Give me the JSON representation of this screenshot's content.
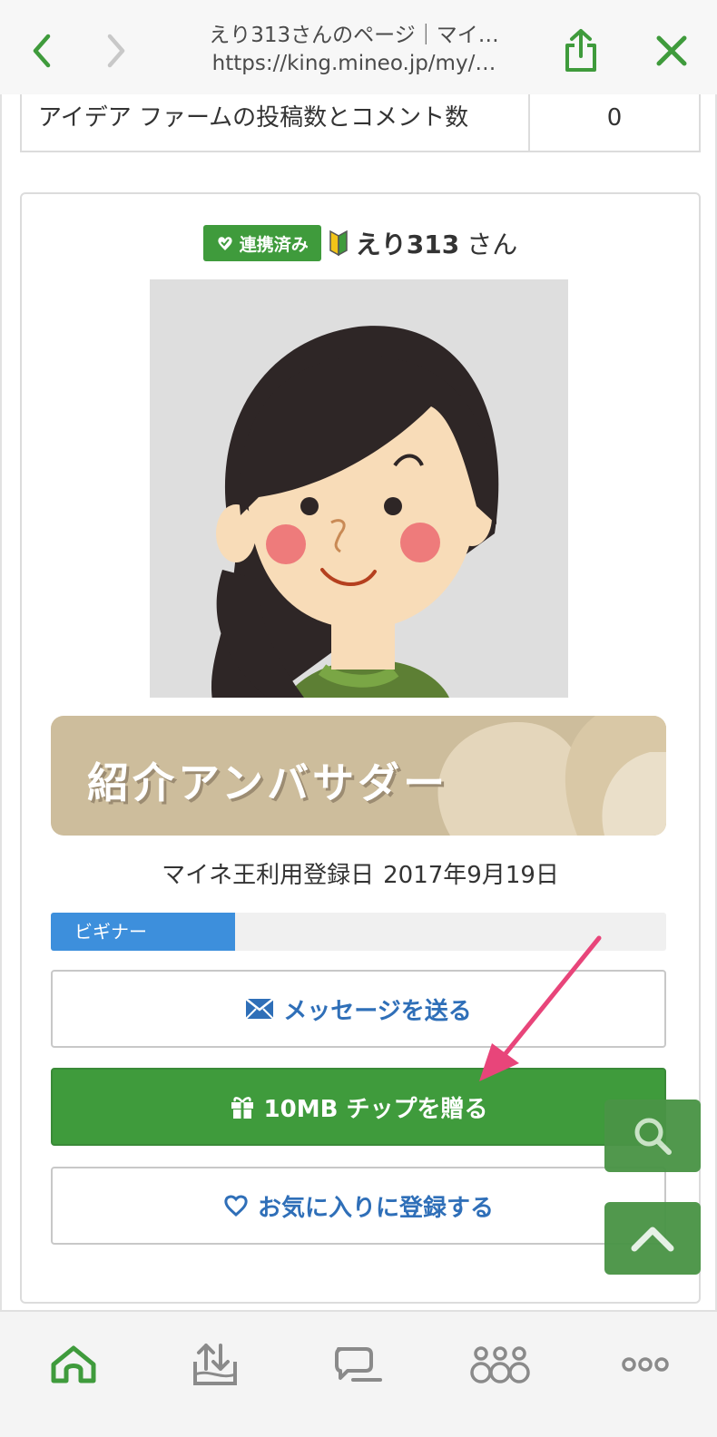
{
  "browser": {
    "page_title": "えり313さんのページ｜マイ…",
    "url": "https://king.mineo.jp/my/…"
  },
  "stats": {
    "label": "アイデア ファームの投稿数とコメント数",
    "value": "0"
  },
  "profile": {
    "linked_badge": "連携済み",
    "username": "えり313",
    "username_suffix": "さん",
    "ambassador_title": "紹介アンバサダー",
    "registration_label": "マイネ王利用登録日",
    "registration_date": "2017年9月19日",
    "level_label": "ビギナー",
    "level_progress": 0.3
  },
  "actions": {
    "message": "メッセージを送る",
    "gift": "10MB チップを贈る",
    "favorite": "お気に入りに登録する"
  },
  "colors": {
    "accent_green": "#3f9b3c",
    "link_blue": "#2f6fb8",
    "progress_blue": "#3d8fdc",
    "annotation_pink": "#e8457a"
  },
  "icons": {
    "back": "chevron-left-icon",
    "forward": "chevron-right-icon",
    "share": "share-icon",
    "close": "close-icon",
    "search": "search-icon",
    "scroll_top": "chevron-up-icon",
    "tabs": [
      "home-icon",
      "data-transfer-icon",
      "chat-icon",
      "community-icon",
      "more-icon"
    ]
  }
}
